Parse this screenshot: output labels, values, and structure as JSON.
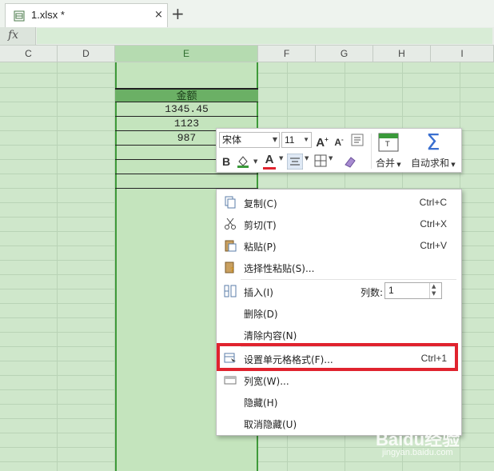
{
  "tab": {
    "title": "1.xlsx *",
    "close": "×",
    "new": "+"
  },
  "formula_bar": {
    "fx": "fx",
    "value": ""
  },
  "columns": [
    "C",
    "D",
    "E",
    "F",
    "G",
    "H",
    "I"
  ],
  "table": {
    "header": "金额",
    "values": [
      "1345.45",
      "1123",
      "987"
    ]
  },
  "mini_toolbar": {
    "font": "宋体",
    "size": "11",
    "grow": "A",
    "shrink": "A",
    "bold": "B",
    "font_color": "A",
    "merge_label": "合并",
    "autosum_label": "自动求和"
  },
  "menu": {
    "copy": {
      "label": "复制(C)",
      "shortcut": "Ctrl+C"
    },
    "cut": {
      "label": "剪切(T)",
      "shortcut": "Ctrl+X"
    },
    "paste": {
      "label": "粘贴(P)",
      "shortcut": "Ctrl+V"
    },
    "paste_special": {
      "label": "选择性粘贴(S)..."
    },
    "insert": {
      "label": "插入(I)",
      "cols_label": "列数:",
      "cols_value": "1"
    },
    "delete": {
      "label": "删除(D)"
    },
    "clear": {
      "label": "清除内容(N)"
    },
    "format_cells": {
      "label": "设置单元格格式(F)...",
      "shortcut": "Ctrl+1"
    },
    "col_width": {
      "label": "列宽(W)..."
    },
    "hide": {
      "label": "隐藏(H)"
    },
    "unhide": {
      "label": "取消隐藏(U)"
    }
  },
  "colors": {
    "accent": "#3f9a3a",
    "highlight": "#e0232e",
    "header_fill": "#6bb065"
  },
  "watermark": {
    "brand": "Baidu经验",
    "url": "jingyan.baidu.com"
  }
}
